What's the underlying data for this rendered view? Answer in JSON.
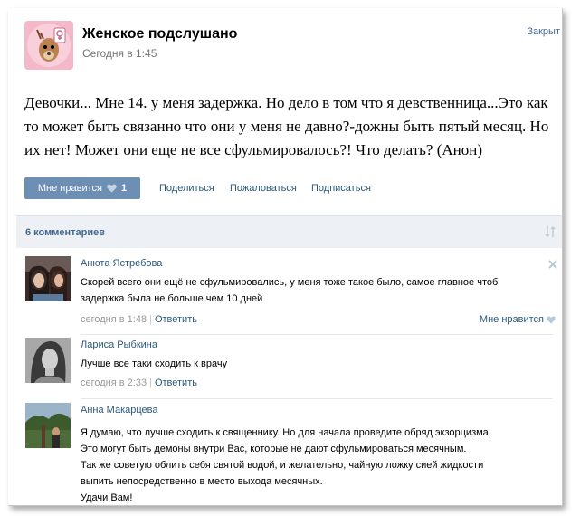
{
  "post": {
    "group_name": "Женское подслушано",
    "time": "Сегодня в 1:45",
    "close_label": "Закрыт",
    "text": "Девочки... Мне 14. у меня задержка. Но дело в том что я девственница...Это как то может быть связанно что они у меня не давно?-дожны быть пятый месяц. Но их нет! Может они еще не все сфульмировалось?! Что делать? (Анон)",
    "like_label": "Мне нравится",
    "like_count": "1",
    "share_label": "Поделиться",
    "report_label": "Пожаловаться",
    "subscribe_label": "Подписаться"
  },
  "comments_header": {
    "count_label": "6 комментариев"
  },
  "comments": [
    {
      "author": "Анюта Ястребова",
      "lines": [
        "Скорей всего они ещё не сфульмировались, у меня тоже такое было, самое главное чтоб",
        "задержка была не больше чем 10 дней"
      ],
      "time": "сегодня в 1:48",
      "reply_label": "Ответить",
      "like_label": "Мне нравится"
    },
    {
      "author": "Лариса Рыбкина",
      "lines": [
        "Лучше все таки сходить к врачу"
      ],
      "time": "сегодня в 2:33",
      "reply_label": "Ответить"
    },
    {
      "author": "Анна Макарцева",
      "lines": [
        "Я думаю, что лучше сходить к священнику. Но для начала проведите обряд экзорцизма.",
        "Это могут быть демоны внутри Вас, которые не дают сфульмироваться месячным.",
        "Так же советую облить себя святой водой, и желательно, чайную ложку сией жидкости",
        "выпить непосредственно в место выхода месячных.",
        "Удачи Вам!"
      ]
    }
  ],
  "icons": {
    "heart": "heart-icon",
    "sort": "sort-icon",
    "close": "close-icon"
  },
  "colors": {
    "accent": "#6d8fb3",
    "link": "#2b587a",
    "header_bg": "#edf1f5"
  }
}
